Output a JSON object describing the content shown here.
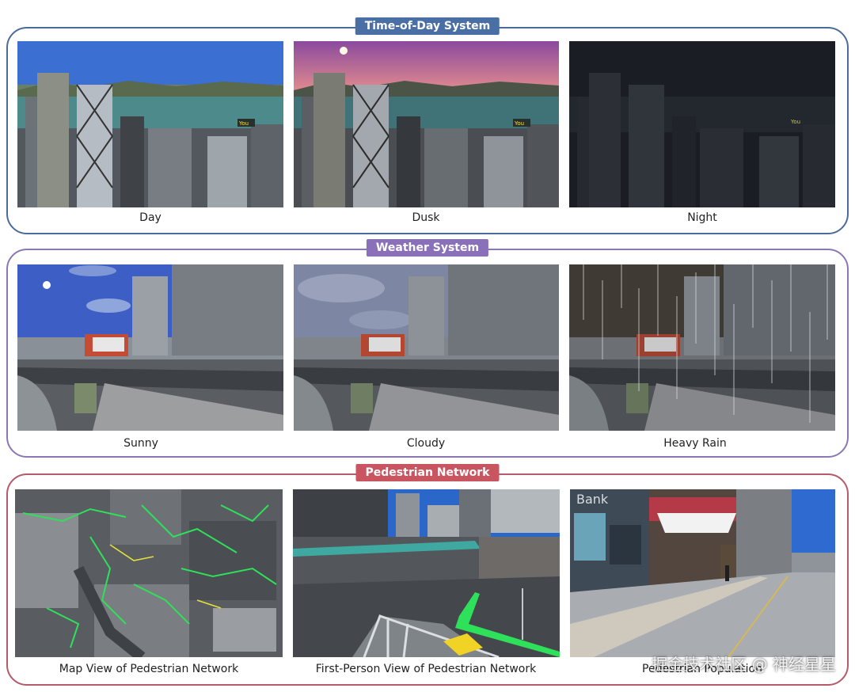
{
  "sections": [
    {
      "title": "Time-of-Day System",
      "captions": [
        "Day",
        "Dusk",
        "Night"
      ]
    },
    {
      "title": "Weather System",
      "captions": [
        "Sunny",
        "Cloudy",
        "Heavy Rain"
      ]
    },
    {
      "title": "Pedestrian Network",
      "captions": [
        "Map View of Pedestrian Network",
        "First-Person View of Pedestrian Network",
        "Pedestrian Population"
      ]
    }
  ],
  "markers": {
    "you": "You"
  },
  "signs": {
    "bank": "Bank"
  },
  "watermark": "掘金技术社区 @ 神经星星",
  "colors": {
    "time_of_day_border": "#4a6b9b",
    "weather_border": "#8b77b6",
    "pedestrian_border": "#b55a68",
    "pedestrian_path": "#2ee05a"
  }
}
